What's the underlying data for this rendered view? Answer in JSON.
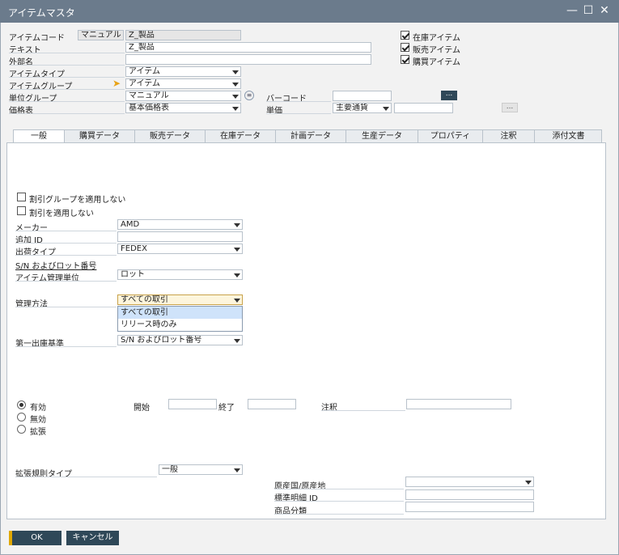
{
  "window": {
    "title": "アイテムマスタ",
    "min_icon": "minimize-icon",
    "max_icon": "maximize-icon",
    "close_icon": "close-icon"
  },
  "header": {
    "item_code_label": "アイテムコード",
    "item_code_mode": "マニュアル",
    "item_code_value": "Z_製品",
    "text_label": "テキスト",
    "text_value": "Z_製品",
    "foreign_name_label": "外部名",
    "foreign_name_value": "",
    "item_type_label": "アイテムタイプ",
    "item_type_value": "アイテム",
    "item_group_label": "アイテムグループ",
    "item_group_value": "アイテム",
    "uom_group_label": "単位グループ",
    "uom_group_value": "マニュアル",
    "price_list_label": "価格表",
    "price_list_value": "基本価格表",
    "barcode_label": "バーコード",
    "barcode_value": "",
    "unit_price_label": "単価",
    "currency_value": "主要通貨",
    "unit_price_value": "",
    "inventory_item_label": "在庫アイテム",
    "sales_item_label": "販売アイテム",
    "purchase_item_label": "購買アイテム",
    "ellipsis": "..."
  },
  "tabs": [
    "一般",
    "購買データ",
    "販売データ",
    "在庫データ",
    "計画データ",
    "生産データ",
    "プロパティ",
    "注釈",
    "添付文書"
  ],
  "general": {
    "no_discount_group_label": "割引グループを適用しない",
    "no_discount_label": "割引を適用しない",
    "manufacturer_label": "メーカー",
    "manufacturer_value": "AMD",
    "additional_id_label": "追加 ID",
    "additional_id_value": "",
    "shipping_type_label": "出荷タイプ",
    "shipping_type_value": "FEDEX",
    "serial_batch_link": "S/N およびロット番号",
    "mgmt_unit_label": "アイテム管理単位",
    "mgmt_unit_value": "ロット",
    "mgmt_method_label": "管理方法",
    "mgmt_method_value": "すべての取引",
    "mgmt_method_options": [
      "すべての取引",
      "リリース時のみ"
    ],
    "first_out_label": "第一出庫基準",
    "first_out_value": "S/N およびロット番号",
    "active_label": "有効",
    "inactive_label": "無効",
    "advanced_label": "拡張",
    "from_label": "開始",
    "to_label": "終了",
    "remarks_label": "注釈",
    "adv_rule_type_label": "拡張規則タイプ",
    "adv_rule_type_value": "一般",
    "country_origin_label": "原産国/原産地",
    "std_item_id_label": "標準明細 ID",
    "commodity_class_label": "商品分類"
  },
  "footer": {
    "ok_label": "OK",
    "cancel_label": "キャンセル"
  },
  "colors": {
    "titlebar": "#6b7b8c",
    "button": "#2f4858",
    "ok_accent": "#e0a800",
    "link_arrow": "#e8a317"
  }
}
